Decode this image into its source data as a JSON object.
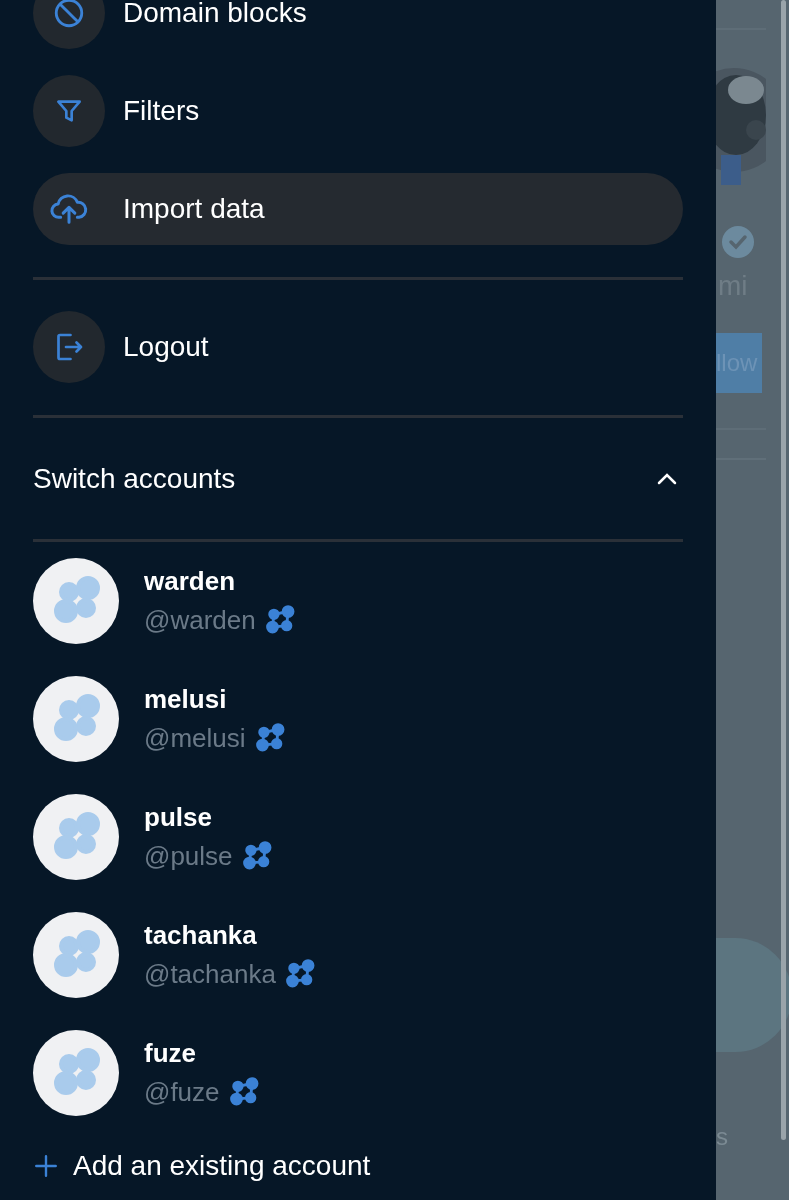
{
  "menu_items": [
    {
      "label": "Domain blocks",
      "selected": false
    },
    {
      "label": "Filters",
      "selected": false
    },
    {
      "label": "Import data",
      "selected": true
    }
  ],
  "logout": {
    "label": "Logout"
  },
  "switch_accounts": {
    "label": "Switch accounts",
    "expanded": true
  },
  "accounts": [
    {
      "name": "warden",
      "handle": "@warden"
    },
    {
      "name": "melusi",
      "handle": "@melusi"
    },
    {
      "name": "pulse",
      "handle": "@pulse"
    },
    {
      "name": "tachanka",
      "handle": "@tachanka"
    },
    {
      "name": "fuze",
      "handle": "@fuze"
    }
  ],
  "add_account": {
    "label": "Add an existing account"
  },
  "background_page": {
    "name_fragment": "mi",
    "button_fragment": "llow",
    "label_fragment": "s"
  }
}
